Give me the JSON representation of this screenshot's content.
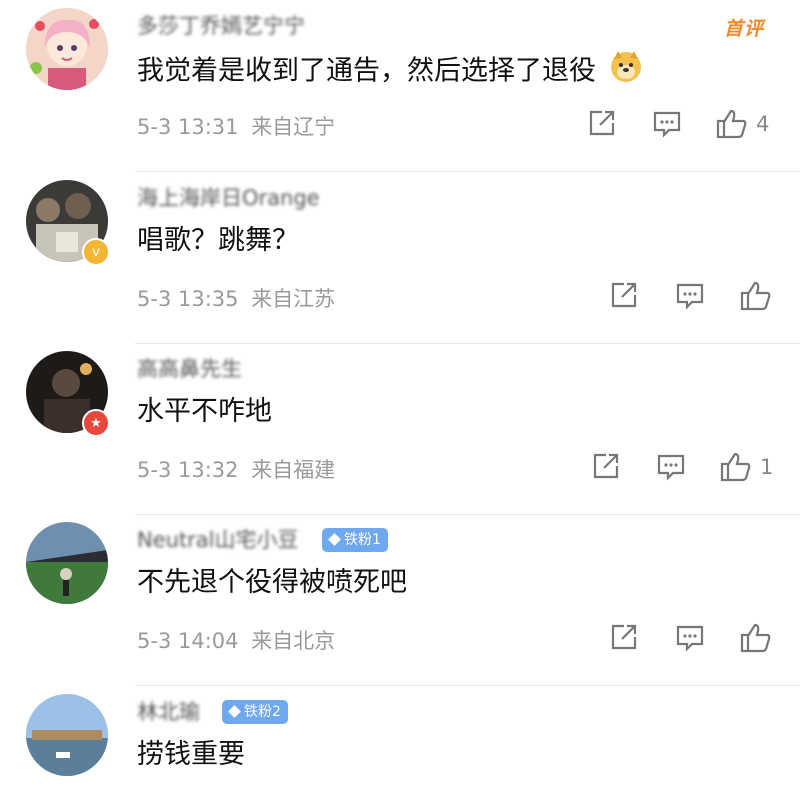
{
  "comments": [
    {
      "username": "多莎丁乔嫣艺宁宁",
      "content": "我觉着是收到了通告，然后选择了退役",
      "date": "5-3 13:31",
      "location": "来自辽宁",
      "likes": "4",
      "first_tag": "首评",
      "emoji": "doge-emoji"
    },
    {
      "username": "海上海岸日Orange",
      "content": "唱歌？跳舞？",
      "date": "5-3 13:35",
      "location": "来自江苏",
      "likes": "",
      "verified_icon": "v"
    },
    {
      "username": "高高鼻先生",
      "content": "水平不咋地",
      "date": "5-3 13:32",
      "location": "来自福建",
      "likes": "1",
      "verified_icon": "★"
    },
    {
      "username": "Neutral山宅小豆",
      "content": "不先退个役得被喷死吧",
      "date": "5-3 14:04",
      "location": "来自北京",
      "likes": "",
      "fan_badge": "铁粉1"
    },
    {
      "username": "林北瑜",
      "content": "捞钱重要",
      "date": "",
      "location": "",
      "likes": "",
      "fan_badge": "铁粉2"
    }
  ],
  "icons": {
    "share": "share-icon",
    "comment": "comment-icon",
    "like": "like-icon"
  },
  "colors": {
    "first_tag": "#f08a2b",
    "fan_badge": "#6fa8ee",
    "meta_text": "#9a9a9a",
    "verified_gold": "#f2b632",
    "verified_red": "#e8483b"
  }
}
